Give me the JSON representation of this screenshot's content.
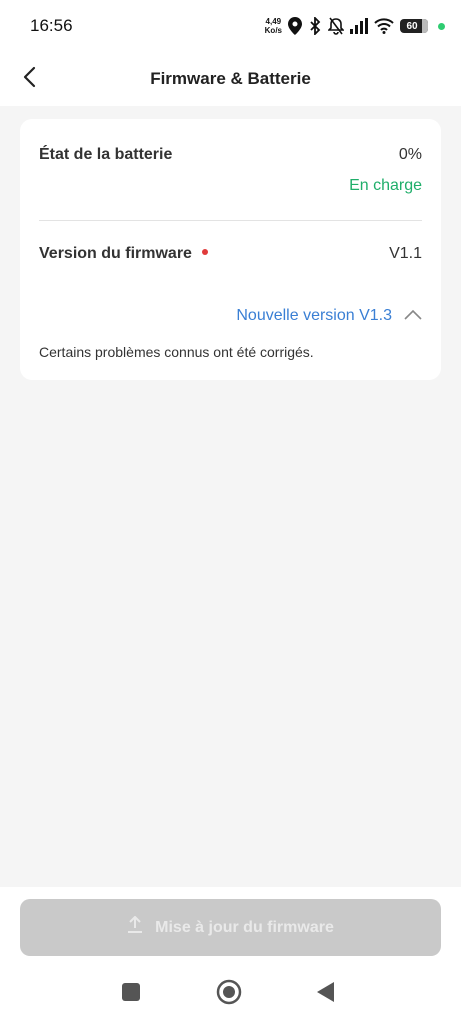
{
  "status_bar": {
    "time": "16:56",
    "net_speed_value": "4,49",
    "net_speed_unit": "Ko/s",
    "battery_level": "60",
    "icons": [
      "location-icon",
      "bluetooth-icon",
      "mute-icon",
      "signal-icon",
      "wifi-icon",
      "battery-icon"
    ]
  },
  "header": {
    "title": "Firmware & Batterie",
    "back_icon": "chevron-left-icon"
  },
  "battery_row": {
    "label": "État de la batterie",
    "value": "0%",
    "status": "En charge"
  },
  "firmware_row": {
    "label": "Version du firmware",
    "value": "V1.1"
  },
  "new_version": {
    "label": "Nouvelle version V1.3",
    "notes": "Certains problèmes connus ont été corrigés."
  },
  "update_button": {
    "label": "Mise à jour du firmware",
    "icon": "upload-icon",
    "enabled": false
  },
  "nav": {
    "icons": [
      "recent-apps-icon",
      "home-icon",
      "back-icon"
    ]
  },
  "colors": {
    "charging": "#1fae6a",
    "link": "#3a7fd4",
    "indicator": "#e03a3a",
    "button_disabled": "#c9c9c9"
  }
}
